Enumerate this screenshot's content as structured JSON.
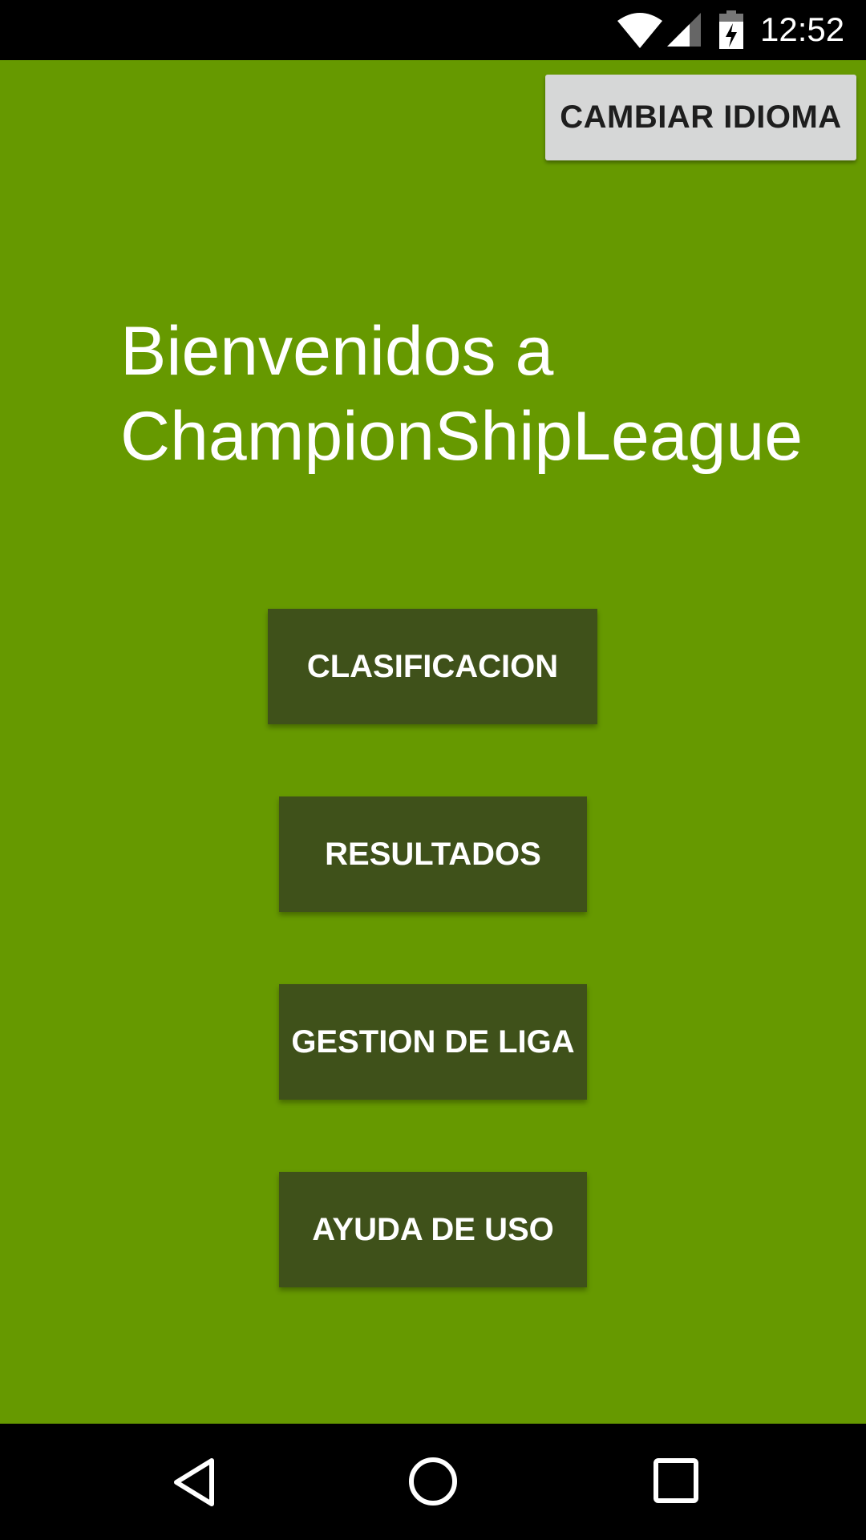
{
  "status_bar": {
    "time": "12:52",
    "icons": [
      "wifi-icon",
      "cell-signal-icon",
      "battery-charging-icon"
    ]
  },
  "toolbar": {
    "change_language_label": "CAMBIAR IDIOMA"
  },
  "main": {
    "title": "Bienvenidos a ChampionShipLeague",
    "buttons": [
      {
        "label": "CLASIFICACION"
      },
      {
        "label": "RESULTADOS"
      },
      {
        "label": "GESTION DE LIGA"
      },
      {
        "label": "AYUDA DE USO"
      }
    ]
  },
  "nav_bar": {
    "icons": [
      "back-icon",
      "home-icon",
      "recents-icon"
    ]
  },
  "colors": {
    "background": "#669900",
    "menu_button": "#3f511a",
    "language_button": "#d6d7d7",
    "system_bars": "#000000"
  }
}
